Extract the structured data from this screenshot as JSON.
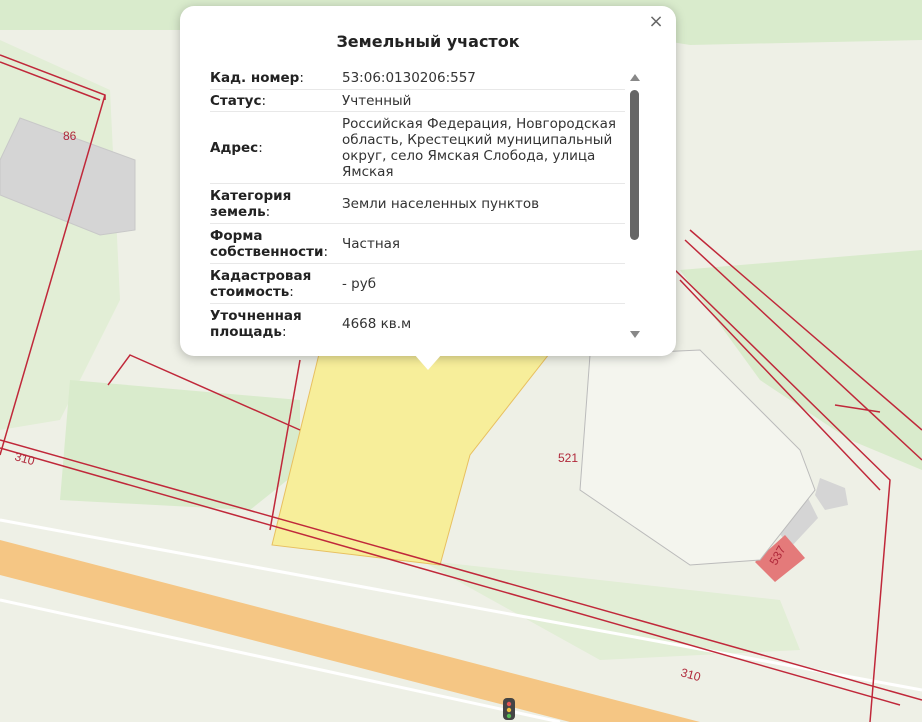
{
  "popup": {
    "title": "Земельный участок",
    "close_glyph": "×",
    "properties": [
      {
        "key": "Кад. номер",
        "value": "53:06:0130206:557"
      },
      {
        "key": "Статус",
        "value": "Учтенный"
      },
      {
        "key": "Адрес",
        "value": "Российская Федерация, Новгородская область, Крестецкий муниципальный округ, село Ямская Слобода, улица Ямская"
      },
      {
        "key": "Категория земель",
        "value": "Земли населенных пунктов"
      },
      {
        "key": "Форма собственности",
        "value": "Частная"
      },
      {
        "key": "Кадастровая стоимость",
        "value": "- руб"
      },
      {
        "key": "Уточненная площадь",
        "value": "4668 кв.м"
      }
    ]
  },
  "map": {
    "labels": {
      "lbl_86": "86",
      "lbl_310_left": "310",
      "lbl_521": "521",
      "lbl_537": "537",
      "lbl_310_bottom": "310"
    },
    "colors": {
      "background": "#eef0e6",
      "green": "#d9ebcc",
      "road": "#f5c684",
      "parcel_border": "#c0283a",
      "selected_parcel": "#f7ee9a",
      "building": "#d5d5d5"
    },
    "icons": [
      "traffic-light-icon"
    ]
  }
}
